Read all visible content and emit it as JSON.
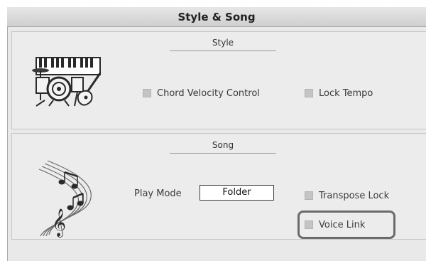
{
  "window": {
    "title": "Style & Song"
  },
  "style_section": {
    "title": "Style",
    "icon": "instruments-icon",
    "chord_velocity_control": {
      "label": "Chord Velocity Control",
      "checked": false
    },
    "lock_tempo": {
      "label": "Lock Tempo",
      "checked": false
    }
  },
  "song_section": {
    "title": "Song",
    "icon": "music-notes-icon",
    "play_mode": {
      "label": "Play Mode",
      "value": "Folder"
    },
    "transpose_lock": {
      "label": "Transpose Lock",
      "checked": false
    },
    "voice_link": {
      "label": "Voice Link",
      "checked": false,
      "highlighted": true
    }
  },
  "colors": {
    "panel_bg": "#ececec",
    "title_bar": "#d8d8d8",
    "checkbox": "#c4c4c4",
    "highlight_border": "#6b6b6b"
  }
}
